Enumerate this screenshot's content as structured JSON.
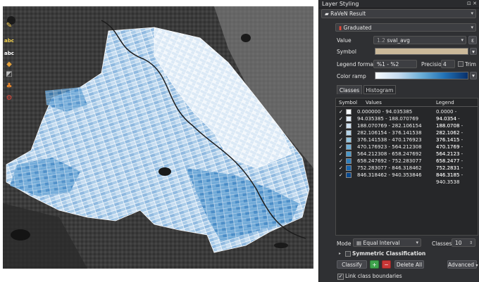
{
  "panel": {
    "title": "Layer Styling",
    "title_buttons": "⊡ ✕",
    "layer_name": "RaVeN Result",
    "renderer": "Graduated",
    "value_label": "Value",
    "value_field": "sval_avg",
    "symbol_label": "Symbol",
    "symbol_color": "#cbb99a",
    "legend_format_label": "Legend format",
    "legend_format_value": "%1 - %2",
    "precision_label": "Precision",
    "precision_value": "4",
    "trim_label": "Trim",
    "color_ramp_label": "Color ramp",
    "tabs": [
      "Classes",
      "Histogram"
    ],
    "table_headers": [
      "Symbol",
      "Values",
      "Legend"
    ],
    "classes": [
      {
        "values": "0.000000 - 94.035385",
        "legend": "0.0000 - 94.0354",
        "color": "#f7fbff"
      },
      {
        "values": "94.035385 - 188.070769",
        "legend": "94.0354 - 188.0708",
        "color": "#e3eef9"
      },
      {
        "values": "188.070769 - 282.106154",
        "legend": "188.0708 - 282.1062",
        "color": "#cfe1f2"
      },
      {
        "values": "282.106154 - 376.141538",
        "legend": "282.1062 - 376.1415",
        "color": "#b5d4e9"
      },
      {
        "values": "376.141538 - 470.176923",
        "legend": "376.1415 - 470.1769",
        "color": "#93c4df"
      },
      {
        "values": "470.176923 - 564.212308",
        "legend": "470.1769 - 564.2123",
        "color": "#6daed5"
      },
      {
        "values": "564.212308 - 658.247692",
        "legend": "564.2123 - 658.2477",
        "color": "#4a98c9"
      },
      {
        "values": "658.247692 - 752.283077",
        "legend": "658.2477 - 752.2831",
        "color": "#2e7ebc"
      },
      {
        "values": "752.283077 - 846.318462",
        "legend": "752.2831 - 846.3185",
        "color": "#1764ab"
      },
      {
        "values": "846.318462 - 940.353846",
        "legend": "846.3185 - 940.3538",
        "color": "#08488e"
      }
    ],
    "mode_label": "Mode",
    "mode_value": "Equal Interval",
    "classes_label": "Classes",
    "classes_count": "10",
    "symmetric_label": "Symmetric Classification",
    "classify_button": "Classify",
    "delete_all_button": "Delete All",
    "advanced_button": "Advanced",
    "link_boundaries_label": "Link class boundaries"
  },
  "colors": {
    "panel_bg": "#2f3033",
    "ramp_start": "#f7fbff",
    "ramp_end": "#08306b",
    "accent_green": "#3fa34d",
    "accent_red": "#c83737"
  }
}
